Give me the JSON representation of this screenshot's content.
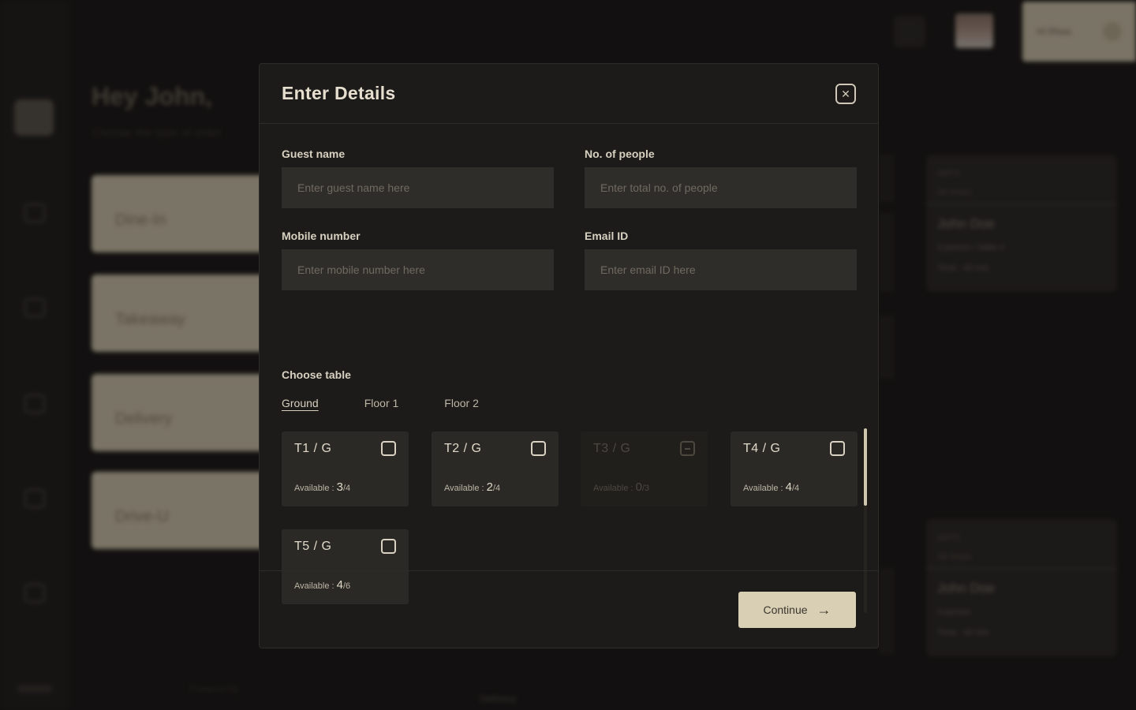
{
  "background": {
    "greeting": "Hey John,",
    "greeting_sub": "Choose the type of order",
    "order_types": [
      "Dine-In",
      "Takeaway",
      "Delivery",
      "Drive-U"
    ],
    "user_chip": "Hi Rhea",
    "powered_by": "Powered by",
    "bottom_tab": "Delivery",
    "right_cards": [
      {
        "head1": "ABTS",
        "head2": "Sit Down",
        "name": "John Doe",
        "meta1": "4 person / table 4",
        "meta2": "Time : 40 min"
      },
      {
        "head1": "ABTS",
        "head2": "Sit Down",
        "name": "John Doe",
        "meta1": "4 person",
        "meta2": "Time : 40 min"
      }
    ]
  },
  "modal": {
    "title": "Enter Details",
    "close_icon": "close-icon",
    "fields": {
      "guest_name": {
        "label": "Guest name",
        "placeholder": "Enter guest name here",
        "value": ""
      },
      "people": {
        "label": "No. of people",
        "placeholder": "Enter total no. of people",
        "value": ""
      },
      "mobile": {
        "label": "Mobile number",
        "placeholder": "Enter mobile number here",
        "value": ""
      },
      "email": {
        "label": "Email ID",
        "placeholder": "Enter email ID here",
        "value": ""
      }
    },
    "choose_table_label": "Choose table",
    "floor_tabs": [
      "Ground",
      "Floor 1",
      "Floor 2"
    ],
    "active_floor": "Ground",
    "tables": [
      {
        "name": "T1 / G",
        "available_label": "Available :",
        "available": "3",
        "capacity": "/4",
        "disabled": false
      },
      {
        "name": "T2 / G",
        "available_label": "Available :",
        "available": "2",
        "capacity": "/4",
        "disabled": false
      },
      {
        "name": "T3 / G",
        "available_label": "Available :",
        "available": "0",
        "capacity": "/3",
        "disabled": true
      },
      {
        "name": "T4 / G",
        "available_label": "Available :",
        "available": "4",
        "capacity": "/4",
        "disabled": false
      },
      {
        "name": "T5 / G",
        "available_label": "Available :",
        "available": "4",
        "capacity": "/6",
        "disabled": false
      }
    ],
    "continue_label": "Continue",
    "continue_icon": "arrow-right-icon"
  },
  "colors": {
    "accent": "#d9cfb5",
    "modal_bg": "#1c1b19",
    "input_bg": "#2f2d2a"
  }
}
